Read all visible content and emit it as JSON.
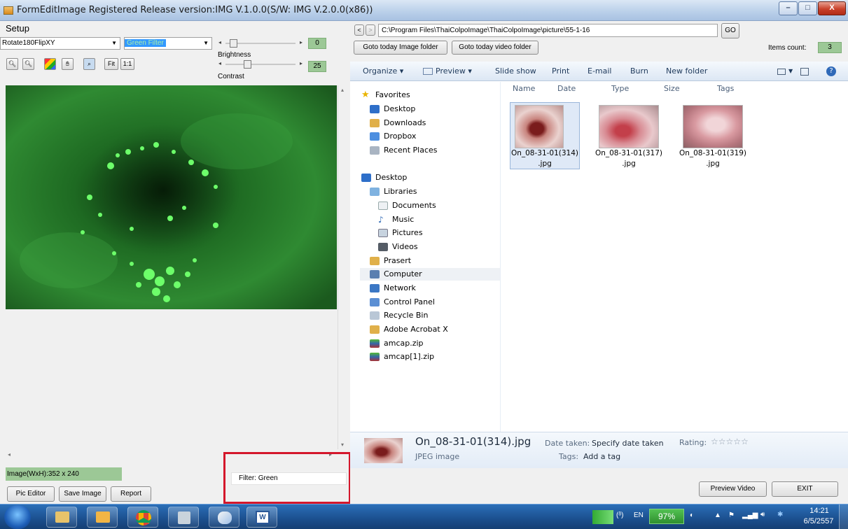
{
  "window": {
    "title": "FormEditImage Registered Release version:IMG V.1.0.0(S/W: IMG V.2.0.0(x86))",
    "controls": {
      "minimize": "–",
      "maximize": "□",
      "close": "X"
    }
  },
  "left": {
    "menu_setup": "Setup",
    "rotate_select": "Rotate180FlipXY",
    "filter_select": "Green Filter",
    "slider_top_value": "0",
    "brightness_label": "Brightness",
    "brightness_value": "25",
    "contrast_label": "Contrast",
    "tools": [
      "zoom-out-icon",
      "zoom-in-icon",
      "color-icon",
      "hand-pan-icon",
      "select-zoom-icon"
    ],
    "fit_label": "Fit",
    "one_to_one_label": "1:1",
    "image_size": "Image(WxH):352 x 240",
    "filter_text": "Filter: Green",
    "buttons": {
      "pic_editor": "Pic Editor",
      "save_image": "Save Image",
      "report": "Report"
    }
  },
  "right": {
    "nav_back": "<",
    "nav_forward": ">",
    "path": "C:\\Program Files\\ThaiColpoImage\\ThaiColpoImage\\picture\\55-1-16",
    "go_label": "GO",
    "today_image": "Goto today Image folder",
    "today_video": "Goto today video folder",
    "items_count_label": "Items count:",
    "items_count_value": "3",
    "toolbar": {
      "organize": "Organize ▾",
      "preview": "Preview ▾",
      "slideshow": "Slide show",
      "print": "Print",
      "email": "E-mail",
      "burn": "Burn",
      "new_folder": "New folder"
    },
    "columns": [
      "Name",
      "Date",
      "Type",
      "Size",
      "Tags"
    ],
    "nav": {
      "favorites": "Favorites",
      "fav_items": [
        "Desktop",
        "Downloads",
        "Dropbox",
        "Recent Places"
      ],
      "desktop": "Desktop",
      "libraries": "Libraries",
      "lib_items": [
        "Documents",
        "Music",
        "Pictures",
        "Videos"
      ],
      "others": [
        "Prasert",
        "Computer",
        "Network",
        "Control Panel",
        "Recycle Bin",
        "Adobe Acrobat X",
        "amcap.zip",
        "amcap[1].zip"
      ]
    },
    "files": [
      {
        "line1": "On_08-31-01(314)",
        "line2": ".jpg"
      },
      {
        "line1": "On_08-31-01(317)",
        "line2": ".jpg"
      },
      {
        "line1": "On_08-31-01(319)",
        "line2": ".jpg"
      }
    ],
    "details": {
      "filename": "On_08-31-01(314).jpg",
      "date_taken_label": "Date taken:",
      "date_taken_value": "Specify date taken",
      "type": "JPEG image",
      "tags_label": "Tags:",
      "tags_value": "Add a tag",
      "rating_label": "Rating:",
      "rating_stars": "☆☆☆☆☆"
    },
    "preview_video": "Preview Video",
    "exit": "EXIT"
  },
  "taskbar": {
    "lang": "EN",
    "battery": "97%",
    "time": "14:21",
    "date": "6/5/2557"
  }
}
